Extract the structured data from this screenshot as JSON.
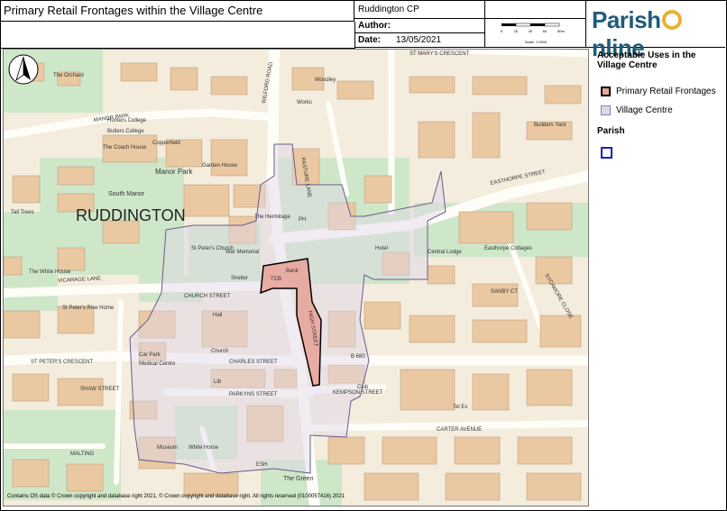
{
  "header": {
    "title": "Primary Retail Frontages within the Village Centre",
    "parish": "Ruddington CP",
    "author_label": "Author:",
    "author_value": "",
    "date_label": "Date:",
    "date_value": "13/05/2021",
    "scale_text": "Scale: 1:2500",
    "scale_ticks": [
      "0",
      "20",
      "40",
      "60",
      "80m"
    ]
  },
  "logo": {
    "part1": "Parish",
    "part2": "nline"
  },
  "legend": {
    "title": "Acceptable Uses in the Village Centre",
    "items": [
      {
        "label": "Primary Retail Frontages",
        "color": "#e8a59d"
      },
      {
        "label": "Village Centre",
        "color": "#ddd8e8"
      }
    ],
    "parish_heading": "Parish",
    "parish_color": "#1d1dd6"
  },
  "map": {
    "village_name": "RUDDINGTON",
    "labels": {
      "orchard": "The Orchard",
      "hunters": "Hunters College",
      "butlers": "Butlers College",
      "coach": "The Coach House",
      "copperfield": "Copperfield",
      "manor_park": "Manor Park",
      "garden_house": "Garden House",
      "south_manor": "South Manor",
      "tall_trees": "Tall Trees",
      "hermitage": "The Hermitage",
      "st_peters": "St Peter's Church",
      "war_memorial": "War Memorial",
      "shelter": "Shelter",
      "white_house": "The White House",
      "st_peters_rise": "St Peter's Rise Home",
      "hall": "Hall",
      "church": "Church",
      "car_park": "Car Park",
      "medical": "Medical Centre",
      "library": "Lib",
      "club": "Club",
      "museum": "Museum",
      "white_horse": "White Horse",
      "the_green": "The Green",
      "works": "Works",
      "woodley": "Woodley",
      "builders_yard": "Builders Yard",
      "easthorpe_cottages": "Easthorpe Cottages",
      "central_lodge": "Central Lodge",
      "tel_ex": "Tel Ex",
      "hotel": "Hotel",
      "ph": "PH",
      "toilet": "TCB",
      "bank": "Bank",
      "road_vicarage": "VICARAGE LANE",
      "road_church": "CHURCH STREET",
      "road_charles": "CHARLES STREET",
      "road_parkyns": "PARKYNS STREET",
      "road_kempson": "KEMPSON STREET",
      "road_carter": "CARTER AVENUE",
      "road_easthorpe": "EASTHORPE STREET",
      "road_st_marys": "ST MARY'S CRESCENT",
      "road_st_peters": "ST PETER'S CRESCENT",
      "road_manor": "MANOR PARK",
      "road_high": "HIGH STREET",
      "road_shaw": "SHAW STREET",
      "road_malting": "MALTING",
      "road_sanby": "SANBY CT",
      "road_pasture": "PASTURE LANE",
      "road_b680": "B 680",
      "road_wilford": "WILFORD ROAD",
      "road_sycamore": "SYCAMORE CLOSE",
      "road_esh": "ESH"
    }
  },
  "copyright": "Contains OS data © Crown copyright and database right 2021, © Crown copyright and database right. All rights reserved (0100057416) 2021"
}
